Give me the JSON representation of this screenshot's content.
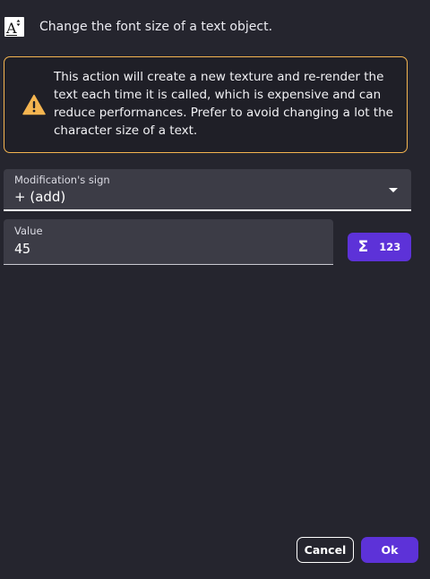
{
  "header": {
    "description": "Change the font size of a text object.",
    "icon": "text-object-icon"
  },
  "warning": {
    "icon": "warning-icon",
    "text": "This action will create a new texture and re-render the text each time it is called, which is expensive and can reduce performances. Prefer to avoid changing a lot the character size of a text.",
    "color": "#f5b550"
  },
  "fields": {
    "sign": {
      "label": "Modification's sign",
      "value": "+ (add)"
    },
    "value": {
      "label": "Value",
      "value": "45"
    }
  },
  "expression_button": {
    "sigma": "Σ",
    "label": "123"
  },
  "footer": {
    "cancel_label": "Cancel",
    "ok_label": "Ok"
  },
  "colors": {
    "accent": "#5d32d8",
    "background": "#25252e",
    "field": "#3c3c46"
  }
}
